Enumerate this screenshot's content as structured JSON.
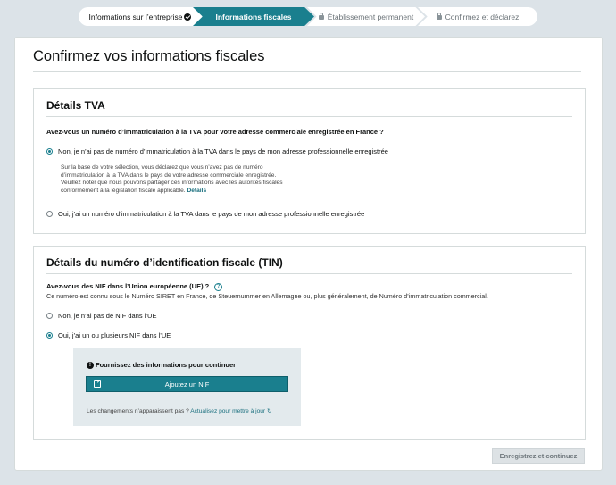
{
  "stepper": {
    "steps": [
      {
        "label": "Informations sur l’entreprise",
        "state": "completed",
        "icon": "check-circle-icon"
      },
      {
        "label": "Informations fiscales",
        "state": "current"
      },
      {
        "label": "Établissement permanent",
        "state": "locked",
        "icon": "lock-icon"
      },
      {
        "label": "Confirmez et déclarez",
        "state": "locked",
        "icon": "lock-icon"
      }
    ]
  },
  "page": {
    "title": "Confirmez vos informations fiscales"
  },
  "tva": {
    "title": "Détails TVA",
    "question": "Avez-vous un numéro d’immatriculation à la TVA pour votre adresse commerciale enregistrée en France ?",
    "option_no": "Non, je n’ai pas de numéro d’immatriculation à la TVA dans le pays de mon adresse professionnelle enregistrée",
    "disclaimer": "Sur la base de votre sélection, vous déclarez que vous n’avez pas de numéro d’immatriculation à la TVA dans le pays de votre adresse commerciale enregistrée. Veuillez noter que nous pouvons partager ces informations avec les autorités fiscales conformément à la législation fiscale applicable.",
    "details_link": "Détails",
    "option_yes": "Oui, j’ai un numéro d’immatriculation à la TVA dans le pays de mon adresse professionnelle enregistrée",
    "selected": "no"
  },
  "tin": {
    "title": "Détails du numéro d’identification fiscale (TIN)",
    "question": "Avez-vous des NIF dans l’Union européenne (UE) ?",
    "help_icon": "question-circle-icon",
    "help": "Ce numéro est connu sous le Numéro SIRET en France, de Steuernummer en Allemagne ou, plus généralement, de Numéro d’immatriculation commercial.",
    "option_no": "Non, je n’ai pas de NIF dans l’UE",
    "option_yes": "Oui, j’ai un ou plusieurs NIF dans l’UE",
    "selected": "yes",
    "callout": {
      "heading": "Fournissez des informations pour continuer",
      "add_button": "Ajoutez un NIF",
      "refresh_text": "Les changements n’apparaissent pas ?",
      "refresh_link": "Actualisez pour mettre à jour"
    }
  },
  "footer": {
    "save_button": "Enregistrez et continuez"
  },
  "colors": {
    "accent": "#1a7f8e",
    "page_bg": "#dce3e8",
    "callout_bg": "#e3eaed"
  }
}
